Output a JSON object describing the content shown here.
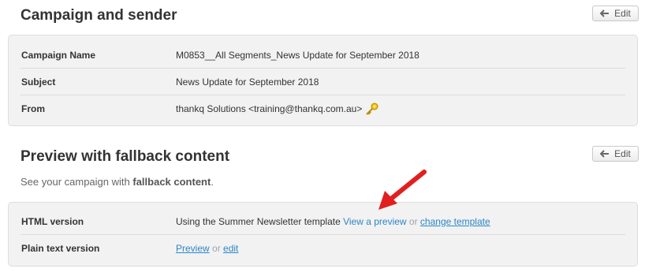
{
  "campaign_section": {
    "title": "Campaign and sender",
    "edit_label": "Edit",
    "rows": [
      {
        "label": "Campaign Name",
        "value": "M0853__All Segments_News Update for September 2018"
      },
      {
        "label": "Subject",
        "value": "News Update for September 2018"
      },
      {
        "label": "From",
        "value": "thankq Solutions <training@thankq.com.au>"
      }
    ]
  },
  "preview_section": {
    "title": "Preview with fallback content",
    "edit_label": "Edit",
    "description_prefix": "See your campaign with ",
    "description_bold": "fallback content",
    "description_suffix": ".",
    "html_row": {
      "label": "HTML version",
      "text": "Using the Summer Newsletter template ",
      "view_preview_link": "View a preview",
      "or1": " or ",
      "change_template_link": "change template"
    },
    "plain_row": {
      "label": "Plain text version",
      "preview_link": "Preview",
      "or": " or ",
      "edit_link": "edit"
    }
  },
  "colors": {
    "link": "#2a86c6",
    "arrow": "#e02020",
    "key_icon": "#e8b400"
  },
  "icons": [
    "arrow-left-icon",
    "key-icon",
    "red-arrow-annotation"
  ]
}
